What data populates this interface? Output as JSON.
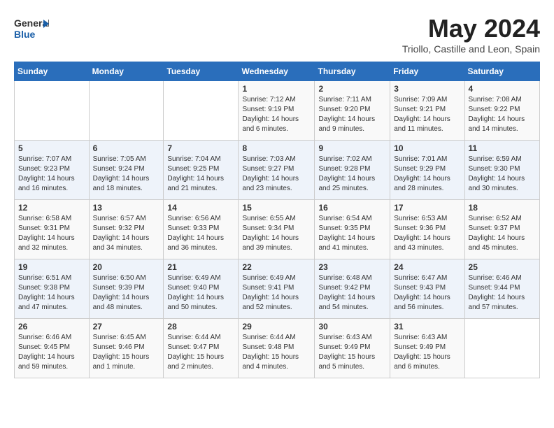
{
  "header": {
    "logo_general": "General",
    "logo_blue": "Blue",
    "month_year": "May 2024",
    "location": "Triollo, Castille and Leon, Spain"
  },
  "calendar": {
    "days_of_week": [
      "Sunday",
      "Monday",
      "Tuesday",
      "Wednesday",
      "Thursday",
      "Friday",
      "Saturday"
    ],
    "weeks": [
      [
        {
          "day": "",
          "info": ""
        },
        {
          "day": "",
          "info": ""
        },
        {
          "day": "",
          "info": ""
        },
        {
          "day": "1",
          "info": "Sunrise: 7:12 AM\nSunset: 9:19 PM\nDaylight: 14 hours\nand 6 minutes."
        },
        {
          "day": "2",
          "info": "Sunrise: 7:11 AM\nSunset: 9:20 PM\nDaylight: 14 hours\nand 9 minutes."
        },
        {
          "day": "3",
          "info": "Sunrise: 7:09 AM\nSunset: 9:21 PM\nDaylight: 14 hours\nand 11 minutes."
        },
        {
          "day": "4",
          "info": "Sunrise: 7:08 AM\nSunset: 9:22 PM\nDaylight: 14 hours\nand 14 minutes."
        }
      ],
      [
        {
          "day": "5",
          "info": "Sunrise: 7:07 AM\nSunset: 9:23 PM\nDaylight: 14 hours\nand 16 minutes."
        },
        {
          "day": "6",
          "info": "Sunrise: 7:05 AM\nSunset: 9:24 PM\nDaylight: 14 hours\nand 18 minutes."
        },
        {
          "day": "7",
          "info": "Sunrise: 7:04 AM\nSunset: 9:25 PM\nDaylight: 14 hours\nand 21 minutes."
        },
        {
          "day": "8",
          "info": "Sunrise: 7:03 AM\nSunset: 9:27 PM\nDaylight: 14 hours\nand 23 minutes."
        },
        {
          "day": "9",
          "info": "Sunrise: 7:02 AM\nSunset: 9:28 PM\nDaylight: 14 hours\nand 25 minutes."
        },
        {
          "day": "10",
          "info": "Sunrise: 7:01 AM\nSunset: 9:29 PM\nDaylight: 14 hours\nand 28 minutes."
        },
        {
          "day": "11",
          "info": "Sunrise: 6:59 AM\nSunset: 9:30 PM\nDaylight: 14 hours\nand 30 minutes."
        }
      ],
      [
        {
          "day": "12",
          "info": "Sunrise: 6:58 AM\nSunset: 9:31 PM\nDaylight: 14 hours\nand 32 minutes."
        },
        {
          "day": "13",
          "info": "Sunrise: 6:57 AM\nSunset: 9:32 PM\nDaylight: 14 hours\nand 34 minutes."
        },
        {
          "day": "14",
          "info": "Sunrise: 6:56 AM\nSunset: 9:33 PM\nDaylight: 14 hours\nand 36 minutes."
        },
        {
          "day": "15",
          "info": "Sunrise: 6:55 AM\nSunset: 9:34 PM\nDaylight: 14 hours\nand 39 minutes."
        },
        {
          "day": "16",
          "info": "Sunrise: 6:54 AM\nSunset: 9:35 PM\nDaylight: 14 hours\nand 41 minutes."
        },
        {
          "day": "17",
          "info": "Sunrise: 6:53 AM\nSunset: 9:36 PM\nDaylight: 14 hours\nand 43 minutes."
        },
        {
          "day": "18",
          "info": "Sunrise: 6:52 AM\nSunset: 9:37 PM\nDaylight: 14 hours\nand 45 minutes."
        }
      ],
      [
        {
          "day": "19",
          "info": "Sunrise: 6:51 AM\nSunset: 9:38 PM\nDaylight: 14 hours\nand 47 minutes."
        },
        {
          "day": "20",
          "info": "Sunrise: 6:50 AM\nSunset: 9:39 PM\nDaylight: 14 hours\nand 48 minutes."
        },
        {
          "day": "21",
          "info": "Sunrise: 6:49 AM\nSunset: 9:40 PM\nDaylight: 14 hours\nand 50 minutes."
        },
        {
          "day": "22",
          "info": "Sunrise: 6:49 AM\nSunset: 9:41 PM\nDaylight: 14 hours\nand 52 minutes."
        },
        {
          "day": "23",
          "info": "Sunrise: 6:48 AM\nSunset: 9:42 PM\nDaylight: 14 hours\nand 54 minutes."
        },
        {
          "day": "24",
          "info": "Sunrise: 6:47 AM\nSunset: 9:43 PM\nDaylight: 14 hours\nand 56 minutes."
        },
        {
          "day": "25",
          "info": "Sunrise: 6:46 AM\nSunset: 9:44 PM\nDaylight: 14 hours\nand 57 minutes."
        }
      ],
      [
        {
          "day": "26",
          "info": "Sunrise: 6:46 AM\nSunset: 9:45 PM\nDaylight: 14 hours\nand 59 minutes."
        },
        {
          "day": "27",
          "info": "Sunrise: 6:45 AM\nSunset: 9:46 PM\nDaylight: 15 hours\nand 1 minute."
        },
        {
          "day": "28",
          "info": "Sunrise: 6:44 AM\nSunset: 9:47 PM\nDaylight: 15 hours\nand 2 minutes."
        },
        {
          "day": "29",
          "info": "Sunrise: 6:44 AM\nSunset: 9:48 PM\nDaylight: 15 hours\nand 4 minutes."
        },
        {
          "day": "30",
          "info": "Sunrise: 6:43 AM\nSunset: 9:49 PM\nDaylight: 15 hours\nand 5 minutes."
        },
        {
          "day": "31",
          "info": "Sunrise: 6:43 AM\nSunset: 9:49 PM\nDaylight: 15 hours\nand 6 minutes."
        },
        {
          "day": "",
          "info": ""
        }
      ]
    ]
  }
}
